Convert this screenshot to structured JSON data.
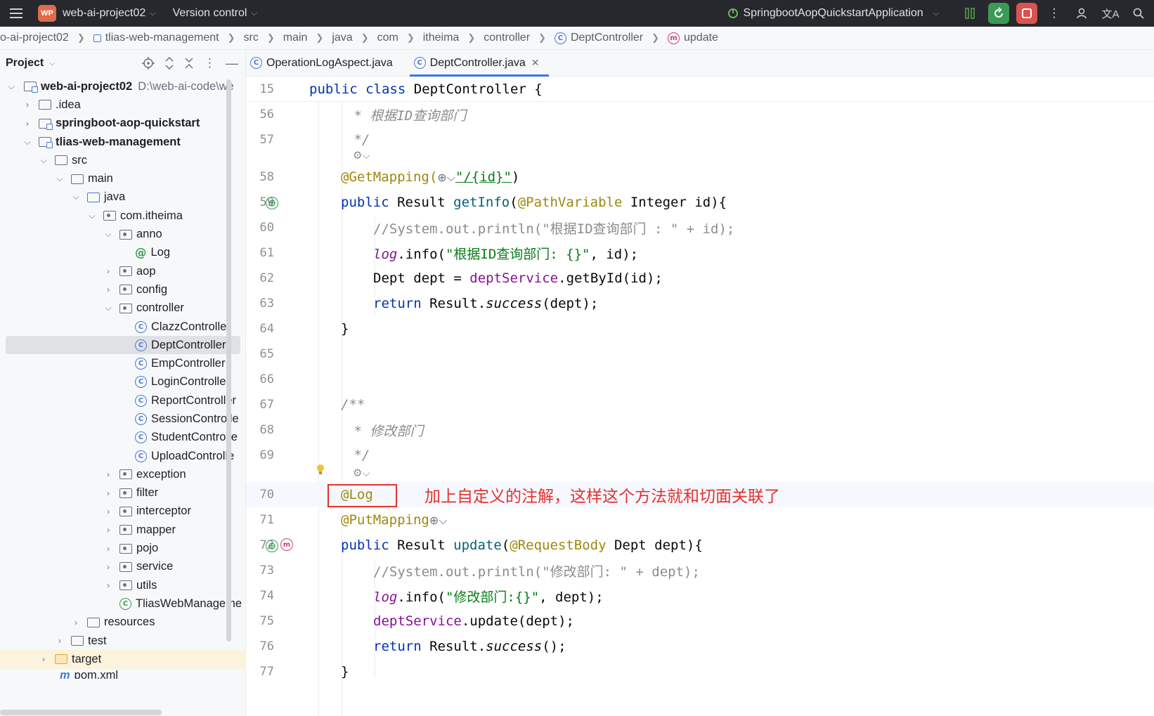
{
  "window": {
    "project_badge": "WP",
    "project_name": "web-ai-project02",
    "vcs_label": "Version control",
    "run_config": "SpringbootAopQuickstartApplication"
  },
  "breadcrumb": [
    "o-ai-project02",
    "tlias-web-management",
    "src",
    "main",
    "java",
    "com",
    "itheima",
    "controller",
    "DeptController",
    "update"
  ],
  "project_panel": {
    "title": "Project",
    "root_name": "web-ai-project02",
    "root_path": "D:\\web-ai-code\\we",
    "items": [
      {
        "label": ".idea"
      },
      {
        "label": "springboot-aop-quickstart"
      },
      {
        "label": "tlias-web-management"
      },
      {
        "label": "src"
      },
      {
        "label": "main"
      },
      {
        "label": "java"
      },
      {
        "label": "com.itheima"
      },
      {
        "label": "anno"
      },
      {
        "label": "Log"
      },
      {
        "label": "aop"
      },
      {
        "label": "config"
      },
      {
        "label": "controller"
      },
      {
        "label": "ClazzController"
      },
      {
        "label": "DeptController"
      },
      {
        "label": "EmpController"
      },
      {
        "label": "LoginController"
      },
      {
        "label": "ReportController"
      },
      {
        "label": "SessionControlle"
      },
      {
        "label": "StudentControlle"
      },
      {
        "label": "UploadControlle"
      },
      {
        "label": "exception"
      },
      {
        "label": "filter"
      },
      {
        "label": "interceptor"
      },
      {
        "label": "mapper"
      },
      {
        "label": "pojo"
      },
      {
        "label": "service"
      },
      {
        "label": "utils"
      },
      {
        "label": "TliasWebManageme"
      },
      {
        "label": "resources"
      },
      {
        "label": "test"
      },
      {
        "label": "target"
      },
      {
        "label": "pom.xml"
      }
    ]
  },
  "tabs": [
    {
      "label": "OperationLogAspect.java"
    },
    {
      "label": "DeptController.java"
    }
  ],
  "editor": {
    "sticky_line": {
      "num": "15",
      "text": "public class DeptController {"
    },
    "line_numbers": [
      "56",
      "57",
      "58",
      "59",
      "60",
      "61",
      "62",
      "63",
      "64",
      "65",
      "66",
      "67",
      "68",
      "69",
      "70",
      "71",
      "72",
      "73",
      "74",
      "75",
      "76",
      "77"
    ],
    "lines": {
      "l56": " * 根据ID查询部门",
      "l57": " */",
      "l58_a": "@GetMapping(",
      "l58_b": "\"/{id}\"",
      "l58_c": ")",
      "l59_kw": "public",
      "l59_type": " Result ",
      "l59_fn": "getInfo",
      "l59_p": "(",
      "l59_an": "@PathVariable",
      "l59_rest": " Integer id){",
      "l60": "//System.out.println(\"根据ID查询部门 : \" + id);",
      "l61_log": "log",
      "l61_mid": ".info(",
      "l61_str": "\"根据ID查询部门: {}\"",
      "l61_end": ", id);",
      "l62_a": "Dept dept = ",
      "l62_fld": "deptService",
      "l62_b": ".getById(id);",
      "l63_kw": "return",
      "l63_a": " Result.",
      "l63_it": "success",
      "l63_b": "(dept);",
      "l64": "}",
      "l67": "/**",
      "l68": " * 修改部门",
      "l69": " */",
      "l70": "@Log",
      "l71": "@PutMapping",
      "l72_kw": "public",
      "l72_type": " Result ",
      "l72_fn": "update",
      "l72_p": "(",
      "l72_an": "@RequestBody",
      "l72_rest": " Dept dept){",
      "l73": "//System.out.println(\"修改部门: \" + dept);",
      "l74_log": "log",
      "l74_mid": ".info(",
      "l74_str": "\"修改部门:{}\"",
      "l74_end": ", dept);",
      "l75_fld": "deptService",
      "l75_b": ".update(dept);",
      "l76_kw": "return",
      "l76_a": " Result.",
      "l76_it": "success",
      "l76_b": "();",
      "l77": "}"
    },
    "annotation_note": "加上自定义的注解，这样这个方法就和切面关联了"
  },
  "colors": {
    "accent": "#3574f0",
    "annotation_red": "#e5312d",
    "run_green": "#3b9b54",
    "stop_red": "#d9534f"
  }
}
